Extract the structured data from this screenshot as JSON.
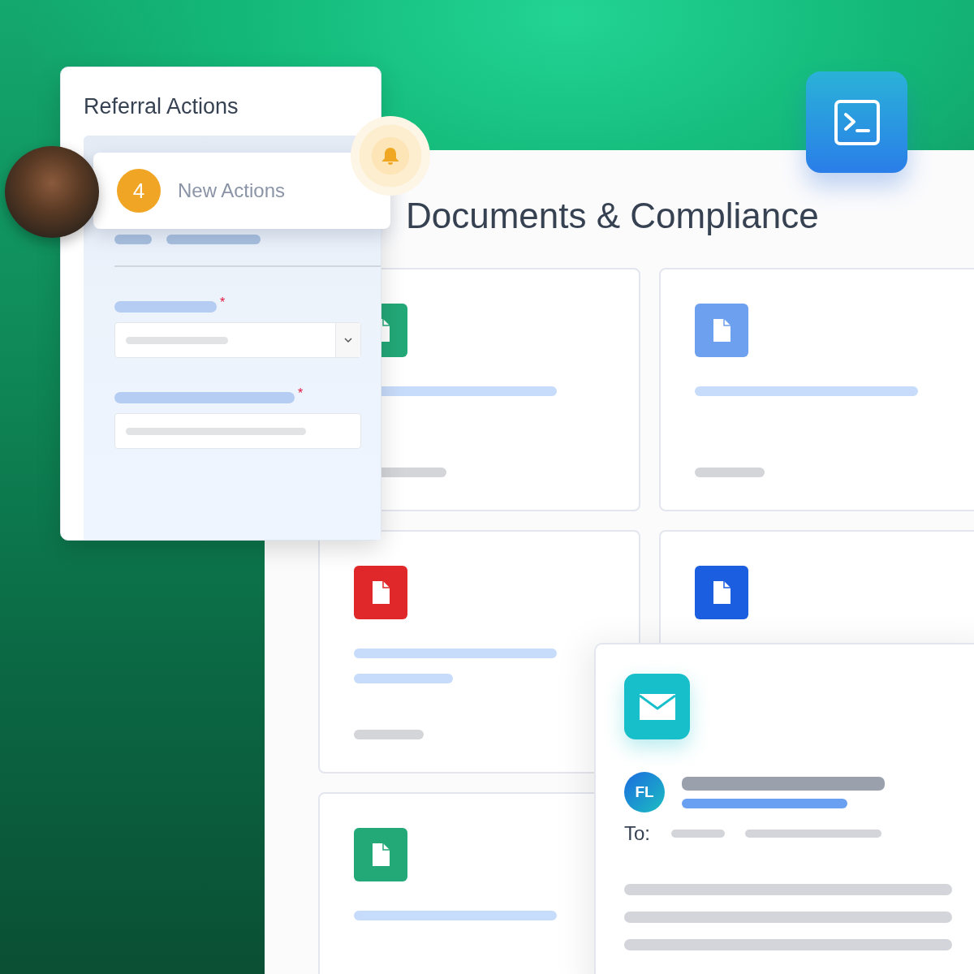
{
  "referral": {
    "title": "Referral Actions",
    "notification": {
      "count": "4",
      "label": "New Actions"
    },
    "fields": [
      {
        "kind": "select",
        "required_mark": "*"
      },
      {
        "kind": "text",
        "required_mark": "*"
      }
    ]
  },
  "documents": {
    "title": "Documents & Compliance",
    "cards": [
      {
        "color": "#23a878"
      },
      {
        "color": "#6ea0f0"
      },
      {
        "color": "#e0282a"
      },
      {
        "color": "#1b5fe0"
      },
      {
        "color": "#23a878"
      }
    ]
  },
  "email": {
    "sender_initials": "FL",
    "to_label": "To:"
  }
}
